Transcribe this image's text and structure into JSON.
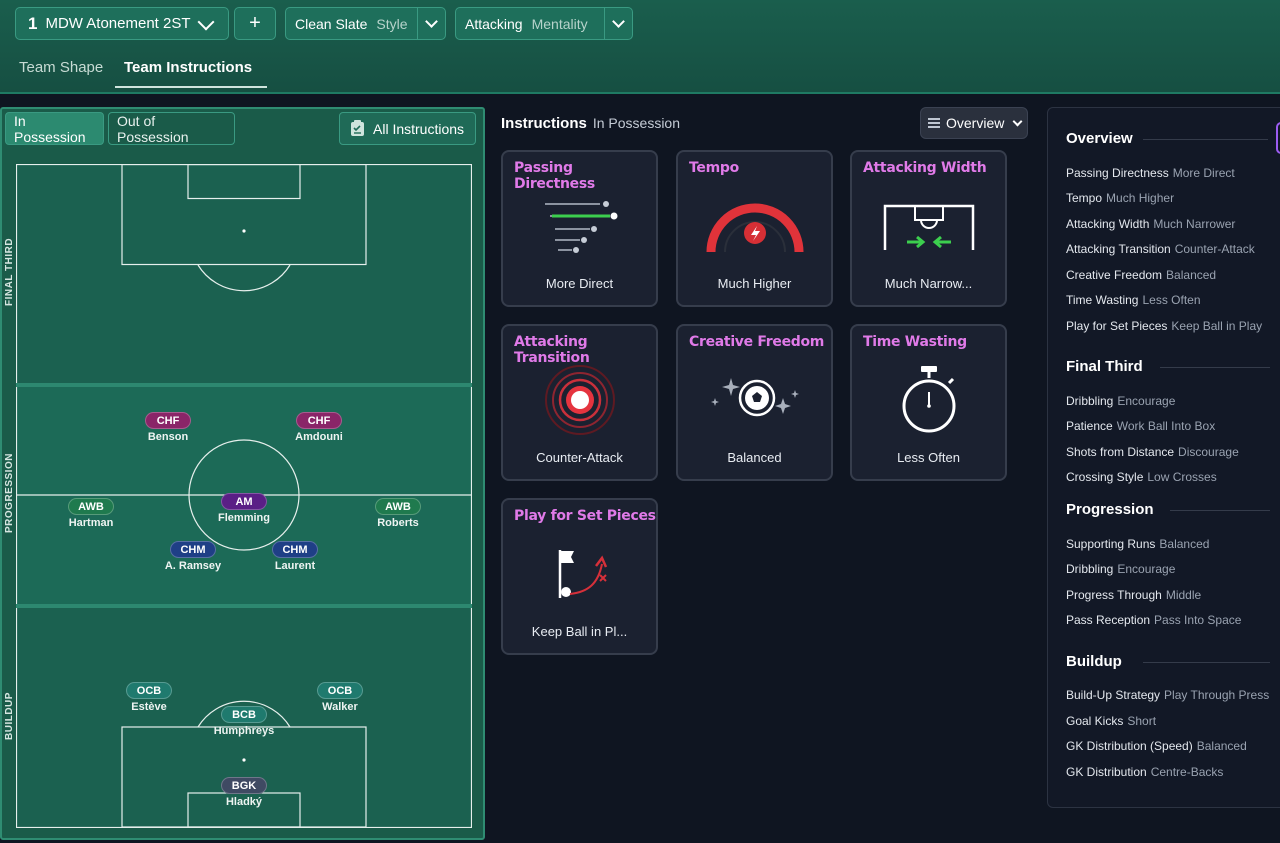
{
  "topbar": {
    "tactic_number": "1",
    "tactic_name": "MDW Atonement 2ST",
    "add_label": "+",
    "style": {
      "value": "Clean Slate",
      "label": "Style"
    },
    "mentality": {
      "value": "Attacking",
      "label": "Mentality"
    },
    "tabs": [
      {
        "label": "Team Shape",
        "active": false
      },
      {
        "label": "Team Instructions",
        "active": true
      }
    ]
  },
  "pitch_panel": {
    "toggle_in": "In Possession",
    "toggle_out": "Out of Possession",
    "all_instructions": "All Instructions",
    "zones": [
      "FINAL THIRD",
      "PROGRESSION",
      "BUILDUP"
    ],
    "players": [
      {
        "role": "CHF",
        "name": "Benson",
        "color": "#8a2568"
      },
      {
        "role": "CHF",
        "name": "Amdouni",
        "color": "#8a2568"
      },
      {
        "role": "AM",
        "name": "Flemming",
        "color": "#5a1f86"
      },
      {
        "role": "AWB",
        "name": "Hartman",
        "color": "#1f7a4e"
      },
      {
        "role": "AWB",
        "name": "Roberts",
        "color": "#1f7a4e"
      },
      {
        "role": "CHM",
        "name": "A. Ramsey",
        "color": "#1f3f86"
      },
      {
        "role": "CHM",
        "name": "Laurent",
        "color": "#1f3f86"
      },
      {
        "role": "OCB",
        "name": "Estève",
        "color": "#1f7a6e"
      },
      {
        "role": "OCB",
        "name": "Walker",
        "color": "#1f7a6e"
      },
      {
        "role": "BCB",
        "name": "Humphreys",
        "color": "#1f7a6e"
      },
      {
        "role": "BGK",
        "name": "Hladký",
        "color": "#3f4a63"
      }
    ]
  },
  "instructions": {
    "title": "Instructions",
    "subtitle": "In Possession",
    "view_select": "Overview",
    "cards": [
      {
        "title": "Passing Directness",
        "value": "More Direct",
        "icon": "passing-arrows-icon"
      },
      {
        "title": "Tempo",
        "value": "Much Higher",
        "icon": "tempo-gauge-icon"
      },
      {
        "title": "Attacking Width",
        "value": "Much Narrow...",
        "icon": "width-arrows-icon"
      },
      {
        "title": "Attacking Transition",
        "value": "Counter-Attack",
        "icon": "radar-rings-icon"
      },
      {
        "title": "Creative Freedom",
        "value": "Balanced",
        "icon": "sparkle-ball-icon"
      },
      {
        "title": "Time Wasting",
        "value": "Less Often",
        "icon": "stopwatch-icon"
      },
      {
        "title": "Play for Set Pieces",
        "value": "Keep Ball in Pl...",
        "icon": "corner-flag-icon"
      }
    ]
  },
  "overview": {
    "sections": [
      {
        "heading": "Overview",
        "rows": [
          {
            "k": "Passing Directness",
            "v": "More Direct"
          },
          {
            "k": "Tempo",
            "v": "Much Higher"
          },
          {
            "k": "Attacking Width",
            "v": "Much Narrower"
          },
          {
            "k": "Attacking Transition",
            "v": "Counter-Attack"
          },
          {
            "k": "Creative Freedom",
            "v": "Balanced"
          },
          {
            "k": "Time Wasting",
            "v": "Less Often"
          },
          {
            "k": "Play for Set Pieces",
            "v": "Keep Ball in Play"
          }
        ]
      },
      {
        "heading": "Final Third",
        "rows": [
          {
            "k": "Dribbling",
            "v": "Encourage"
          },
          {
            "k": "Patience",
            "v": "Work Ball Into Box"
          },
          {
            "k": "Shots from Distance",
            "v": "Discourage"
          },
          {
            "k": "Crossing Style",
            "v": "Low Crosses"
          }
        ]
      },
      {
        "heading": "Progression",
        "rows": [
          {
            "k": "Supporting Runs",
            "v": "Balanced"
          },
          {
            "k": "Dribbling",
            "v": "Encourage"
          },
          {
            "k": "Progress Through",
            "v": "Middle"
          },
          {
            "k": "Pass Reception",
            "v": "Pass Into Space"
          }
        ]
      },
      {
        "heading": "Buildup",
        "rows": [
          {
            "k": "Build-Up Strategy",
            "v": "Play Through Press"
          },
          {
            "k": "Goal Kicks",
            "v": "Short"
          },
          {
            "k": "GK Distribution (Speed)",
            "v": "Balanced"
          },
          {
            "k": "GK Distribution",
            "v": "Centre-Backs"
          }
        ]
      }
    ]
  },
  "colors": {
    "accent_pink": "#e07ae8",
    "pitch_green": "#1b6150",
    "top_green": "#1a5e4d"
  }
}
